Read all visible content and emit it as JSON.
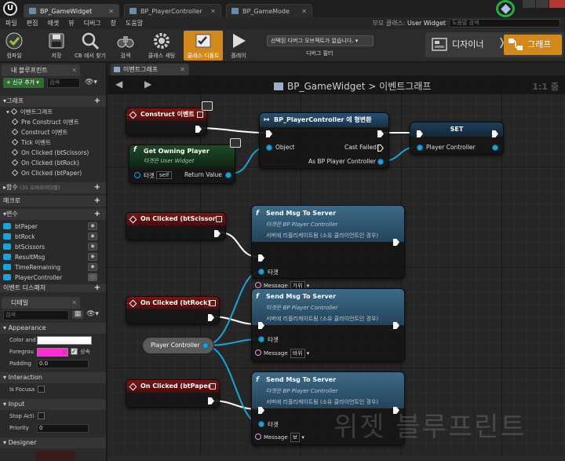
{
  "tabs": [
    {
      "label": "BP_GameWidget"
    },
    {
      "label": "BP_PlayerController"
    },
    {
      "label": "BP_GameMode"
    }
  ],
  "menu": [
    "파일",
    "편집",
    "애셋",
    "뷰",
    "디버그",
    "창",
    "도움말"
  ],
  "parent_class": {
    "label": "부모 클래스:",
    "value": "User Widget"
  },
  "help_search_placeholder": "도움말 검색",
  "toolbar": {
    "compile": "컴파일",
    "save": "저장",
    "find_in_cb": "CB 에서 찾기",
    "search": "검색",
    "class_settings": "클래스 세팅",
    "class_defaults": "클래스 디폴트",
    "play": "플레이",
    "debug_object": "선택된 디버그 오브젝트가 없습니다.",
    "debug_filter": "디버그 필터",
    "mode_designer": "디자이너",
    "mode_graph": "그래프"
  },
  "my_blueprint": {
    "tab": "내 블루프린트",
    "add_new": "+ 신규 추가 ▾",
    "search_placeholder": "검색",
    "graphs_header": "그래프",
    "event_graph": "이벤트그래프",
    "events": [
      "Pre Construct 이벤트",
      "Construct 이벤트",
      "Tick 이벤트",
      "On Clicked (btScissors)",
      "On Clicked (btRock)",
      "On Clicked (btPaper)"
    ],
    "functions_header": "함수",
    "functions_sub": "(31 오버라이더블)",
    "macros_header": "매크로",
    "variables_header": "변수",
    "variables": [
      {
        "name": "btPaper",
        "color": "#17a4d8"
      },
      {
        "name": "btRock",
        "color": "#17a4d8"
      },
      {
        "name": "btScissors",
        "color": "#17a4d8"
      },
      {
        "name": "ResultMsg",
        "color": "#17a4d8"
      },
      {
        "name": "TimeRemaining",
        "color": "#17a4d8"
      },
      {
        "name": "PlayerController",
        "color": "#17a4d8"
      }
    ],
    "event_dispatchers_header": "이벤트 디스패처"
  },
  "details": {
    "tab": "디테일",
    "search_placeholder": "검색",
    "appearance_header": "Appearance",
    "color_and_opacity": "Color and",
    "foreground": "Foregrou",
    "foreground_color": "#ff2ad4",
    "inherit_label": "상속",
    "padding": "Padding",
    "padding_value": "0.0",
    "interaction_header": "Interaction",
    "is_focusable": "Is Focusa",
    "input_header": "Input",
    "stop_action": "Stop Acti",
    "priority": "Priority",
    "priority_value": "0",
    "designer_header": "Designer"
  },
  "graph": {
    "tab": "이벤트그래프",
    "breadcrumb_bp": "BP_GameWidget",
    "breadcrumb_sep": ">",
    "breadcrumb_graph": "이벤트그래프",
    "zoom": "1:1 줌",
    "watermark": "위젯 블루프린트"
  },
  "nodes": {
    "construct": {
      "title": "Construct 이벤트"
    },
    "cast": {
      "title": "BP_PlayerController 에 형변환",
      "object": "Object",
      "cast_failed": "Cast Failed",
      "as_bp": "As BP Player Controller"
    },
    "set": {
      "title": "SET",
      "pin": "Player Controller"
    },
    "get_owning": {
      "title": "Get Owning Player",
      "subtitle": "타겟은 User Widget",
      "target": "타겟",
      "self": "self",
      "return": "Return Value"
    },
    "click_scissors": {
      "title": "On Clicked (btScissors)"
    },
    "click_rock": {
      "title": "On Clicked (btRock)"
    },
    "click_paper": {
      "title": "On Clicked (btPaper)"
    },
    "send_scissors": {
      "title": "Send Msg To Server",
      "line2": "타겟은 BP Player Controller",
      "line3": "서버에 리플리케이트됨 (소유 클라이언트인 경우)",
      "target": "타겟",
      "message": "Message",
      "value": "가위"
    },
    "send_rock": {
      "title": "Send Msg To Server",
      "line2": "타겟은 BP Player Controller",
      "line3": "서버에 리플리케이트됨 (소유 클라이언트인 경우)",
      "target": "타겟",
      "message": "Message",
      "value": "바위"
    },
    "send_paper": {
      "title": "Send Msg To Server",
      "line2": "타겟은 BP Player Controller",
      "line3": "서버에 리플리케이트됨 (소유 클라이언트인 경우)",
      "target": "타겟",
      "message": "Message",
      "value": "보"
    },
    "player_controller_var": {
      "label": "Player Controller"
    }
  },
  "colors": {
    "accent": "#d2891a",
    "exec_wire": "#ffffff",
    "object_wire": "#17a4d8",
    "event_head": "#7a1414"
  }
}
